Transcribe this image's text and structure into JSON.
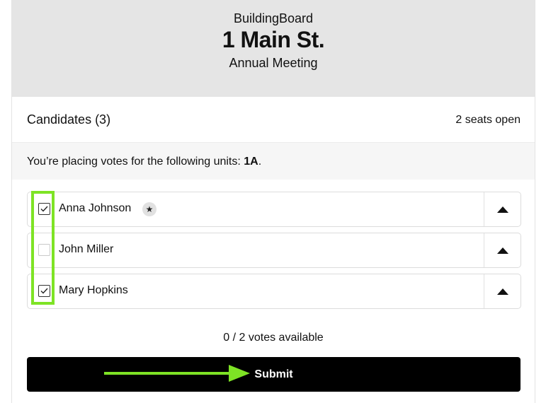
{
  "header": {
    "org": "BuildingBoard",
    "address": "1 Main St.",
    "meeting": "Annual Meeting"
  },
  "candidates_section": {
    "title": "Candidates (3)",
    "seats": "2 seats open"
  },
  "notice": {
    "prefix": "You’re placing votes for the following units: ",
    "unit": "1A",
    "suffix": "."
  },
  "candidates": [
    {
      "name": "Anna Johnson",
      "checked": true,
      "badge": "★",
      "badge_icon": "star-icon"
    },
    {
      "name": "John Miller",
      "checked": false
    },
    {
      "name": "Mary Hopkins",
      "checked": true
    }
  ],
  "votes_available": "0 / 2 votes available",
  "submit_label": "Submit",
  "colors": {
    "header_bg": "#e5e5e5",
    "highlight": "#7ee325",
    "button_bg": "#000000"
  }
}
